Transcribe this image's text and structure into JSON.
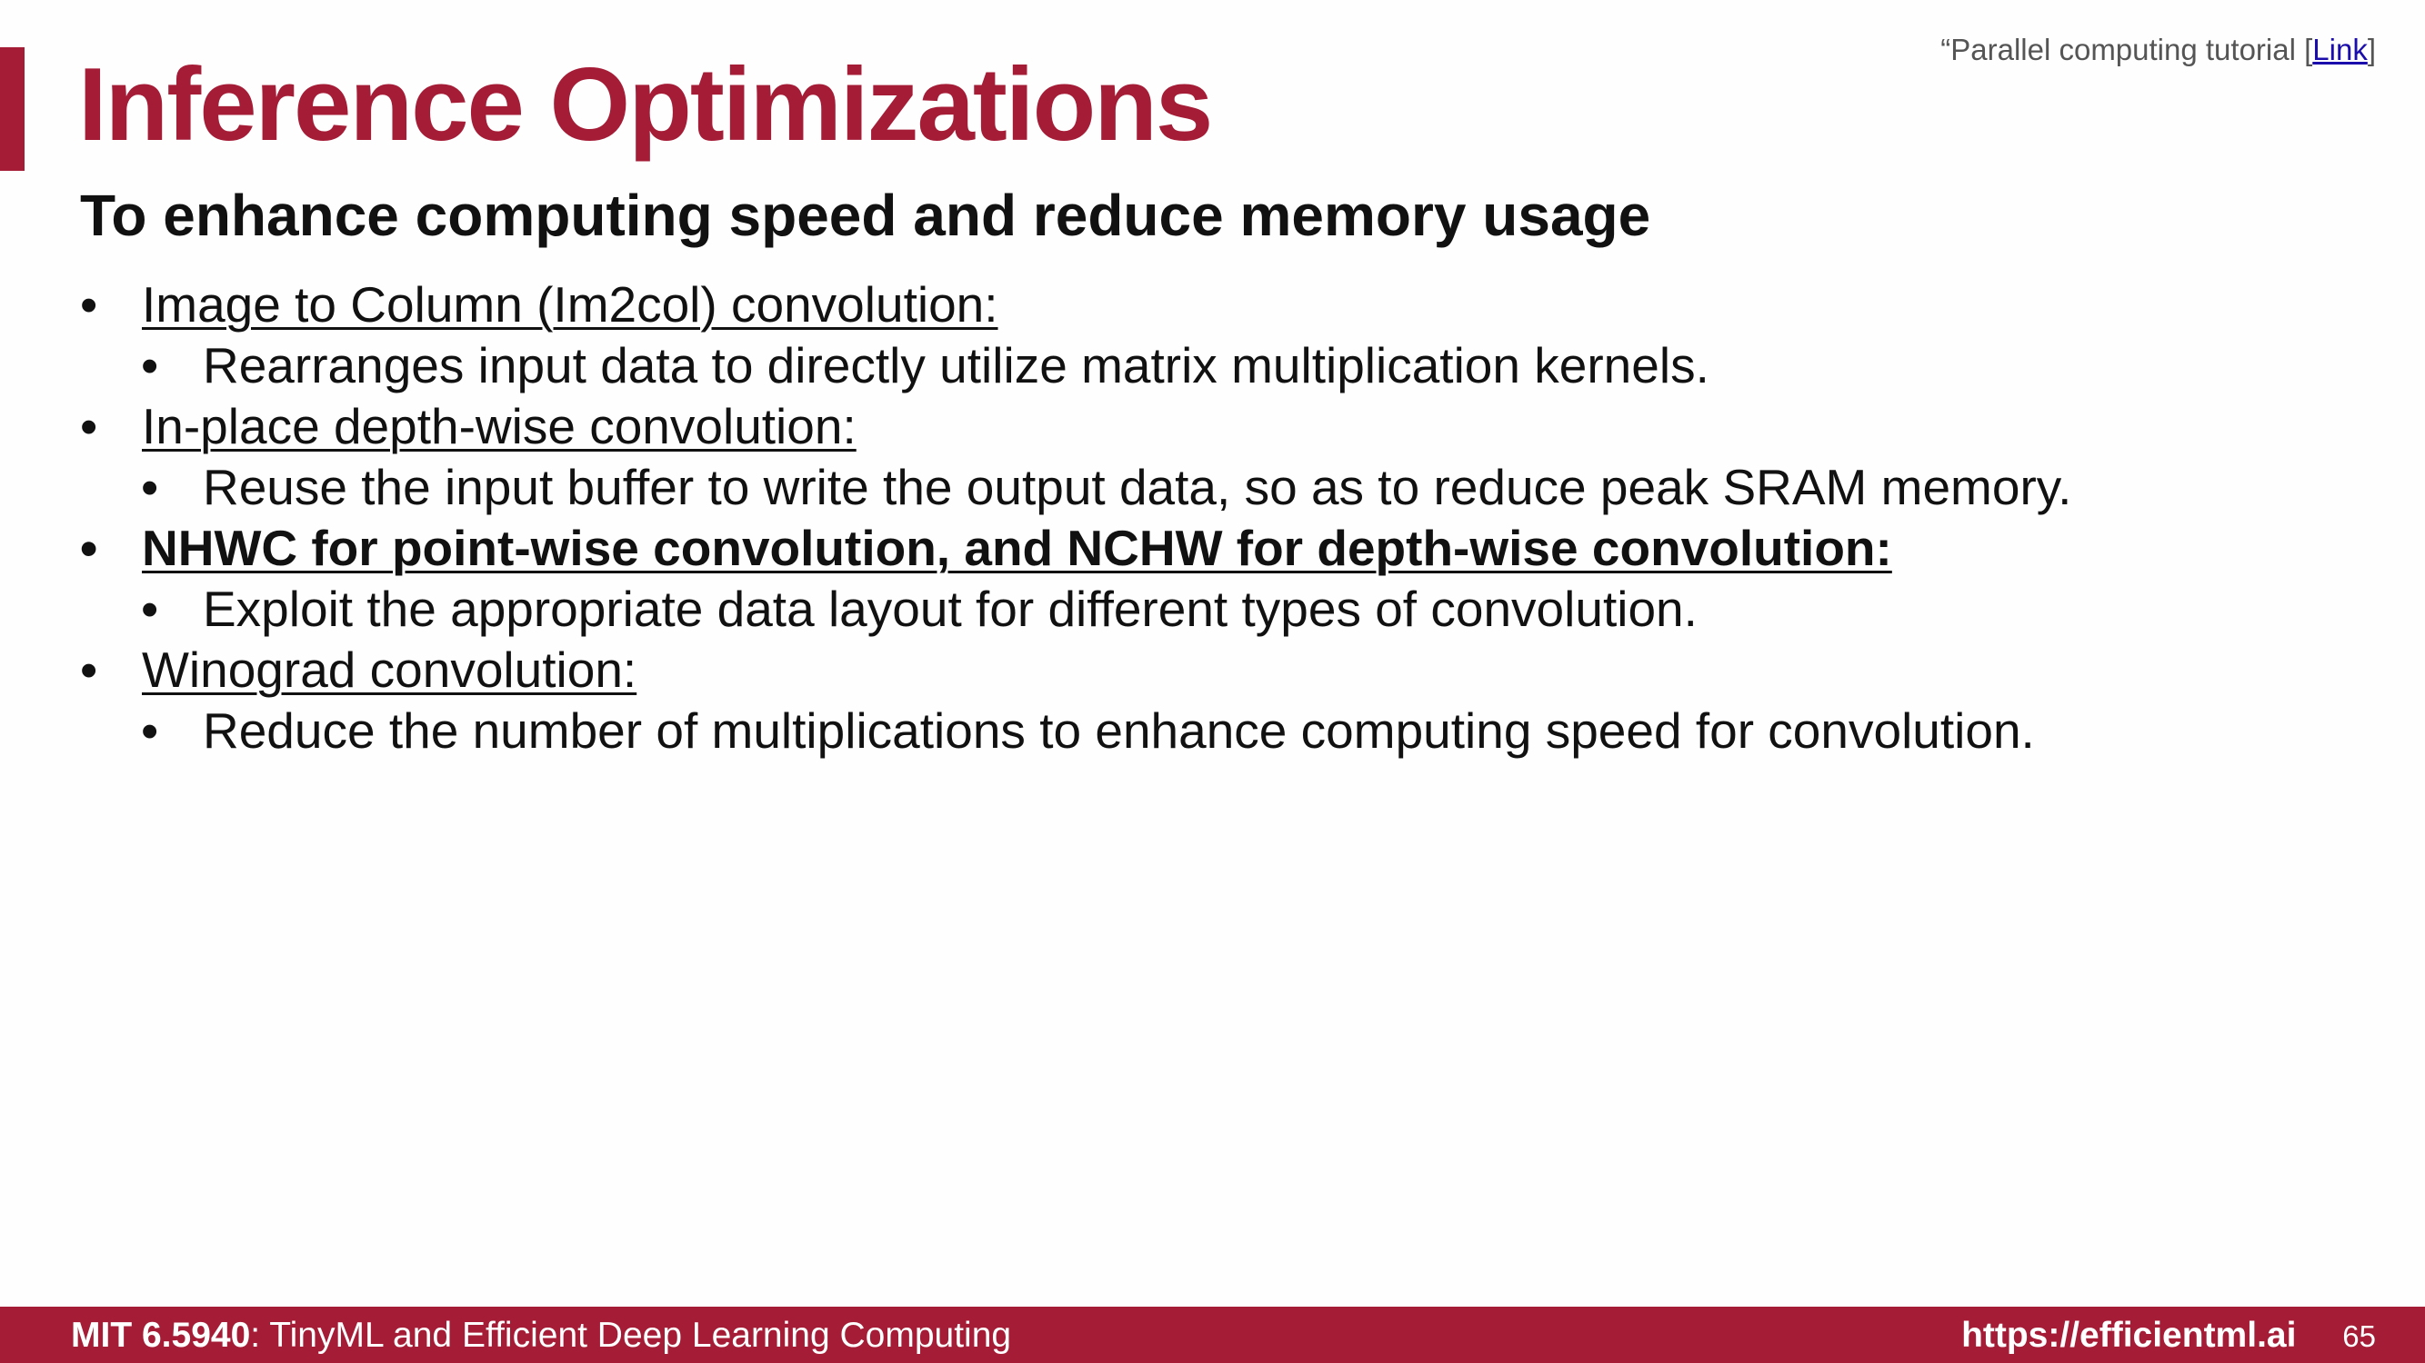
{
  "slide": {
    "title": "Inference Optimizations",
    "subtitle": "To enhance computing speed and reduce memory usage",
    "citation": {
      "prefix": "“Parallel computing tutorial [",
      "link_text": "Link",
      "suffix": "]"
    },
    "bullet_glyph": "•",
    "bullets": [
      {
        "heading": "Image to Column (Im2col) convolution:",
        "bold": false,
        "detail": "Rearranges input data to directly utilize matrix multiplication kernels."
      },
      {
        "heading": "In-place depth-wise convolution:",
        "bold": false,
        "detail": "Reuse the input buffer to write the output data, so as to reduce peak SRAM memory."
      },
      {
        "heading": "NHWC for point-wise convolution, and NCHW for depth-wise convolution:",
        "bold": true,
        "detail": "Exploit the appropriate data layout for different types of convolution."
      },
      {
        "heading": "Winograd convolution:",
        "bold": false,
        "detail": "Reduce the number of multiplications to enhance computing speed for convolution."
      }
    ]
  },
  "footer": {
    "course_code": "MIT 6.5940",
    "course_name": ": TinyML and Efficient Deep Learning Computing",
    "url": "https://efficientml.ai",
    "page_number": "65"
  },
  "colors": {
    "accent": "#a51c37",
    "text": "#111111",
    "link": "#1a0dab"
  }
}
